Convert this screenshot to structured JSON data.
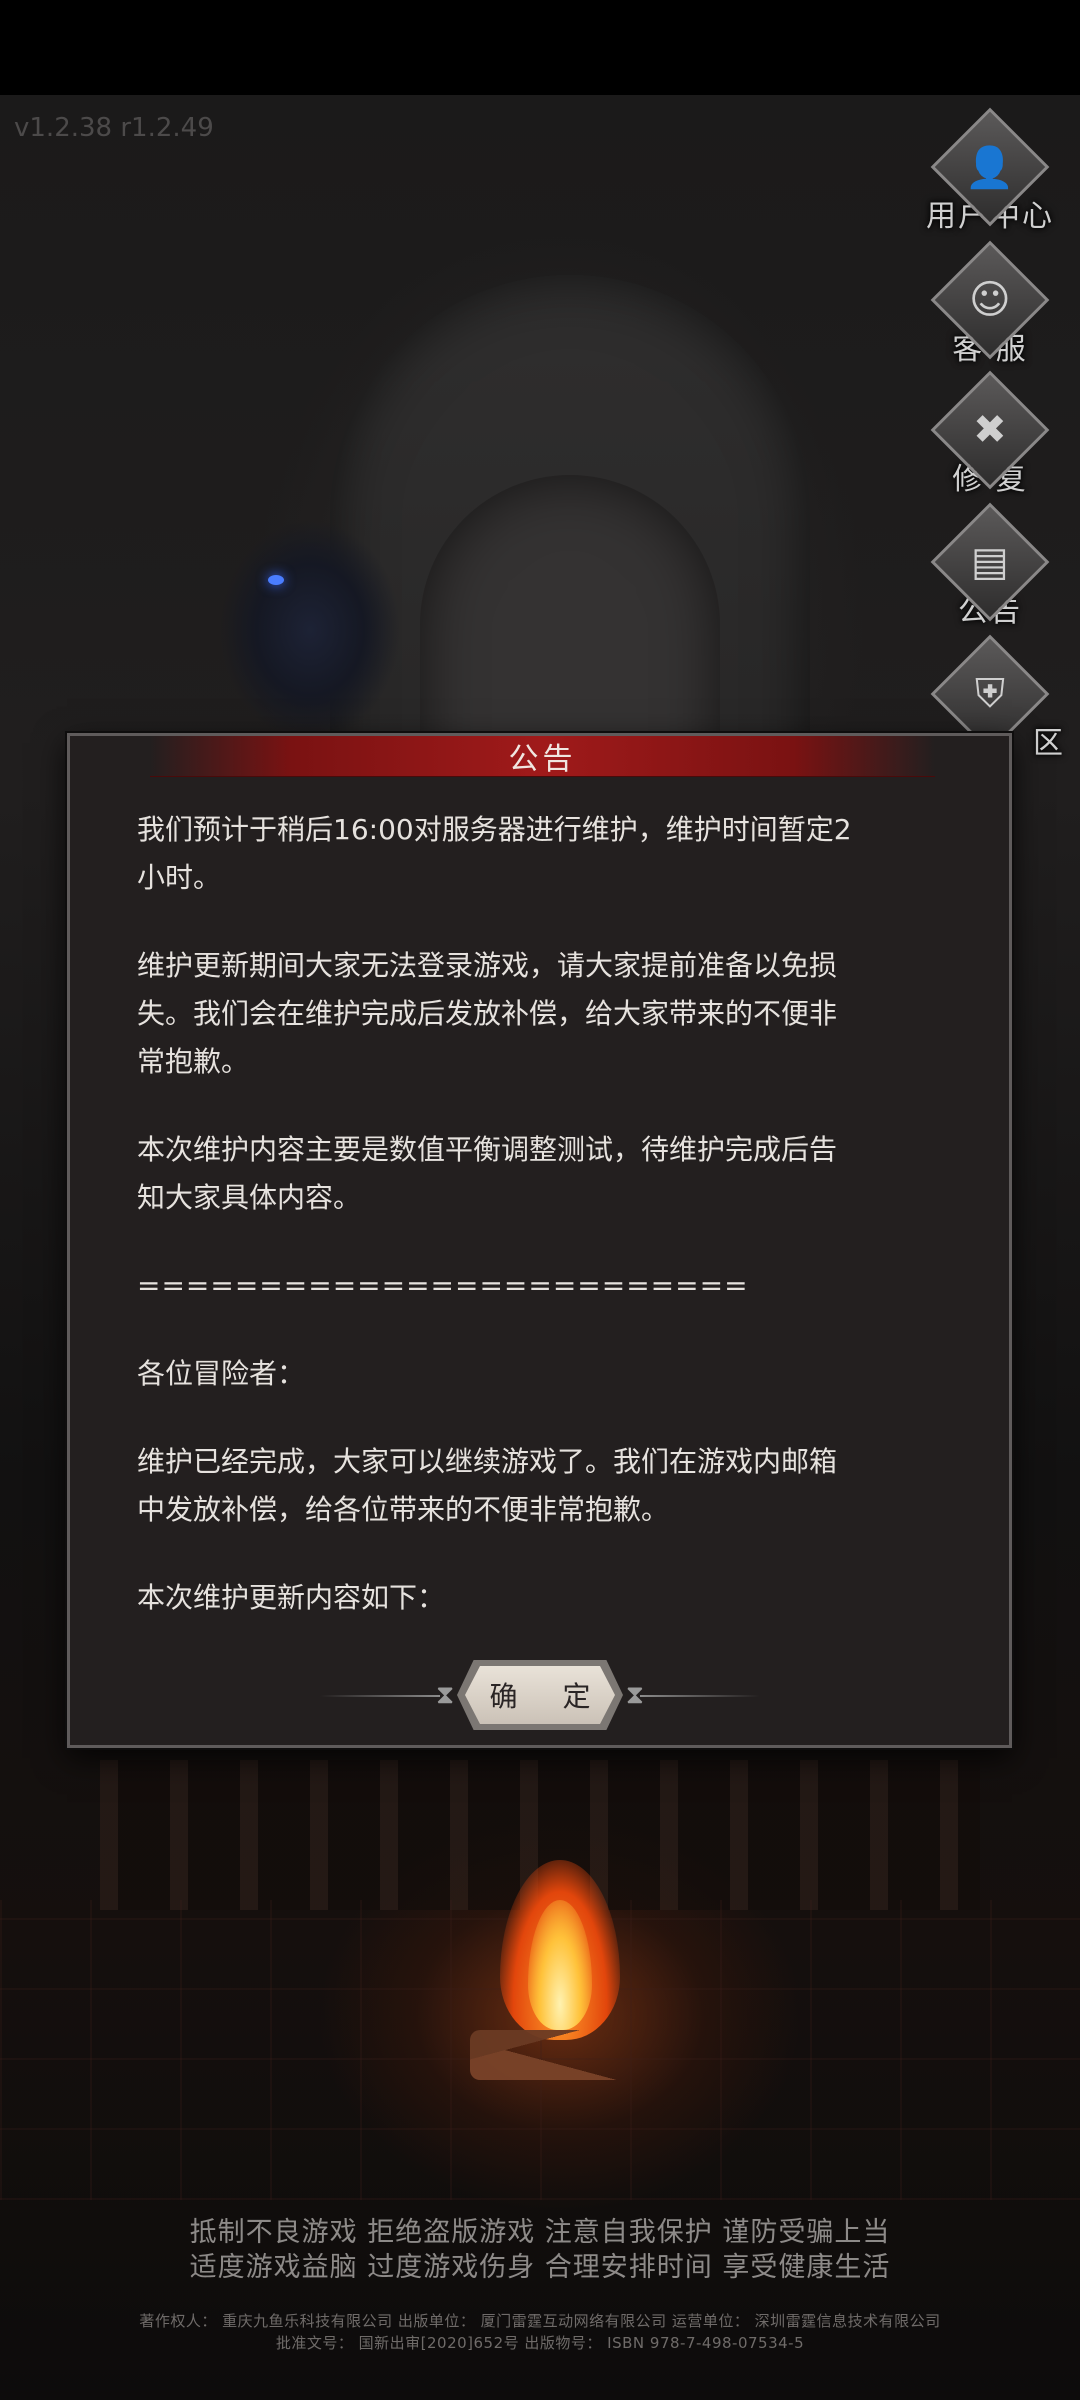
{
  "version": "v1.2.38 r1.2.49",
  "side_menu": [
    {
      "label": "用户中心",
      "icon": "user-icon",
      "glyph": "👤"
    },
    {
      "label": "客 服",
      "icon": "support-agent-icon",
      "glyph": "☺"
    },
    {
      "label": "修 复",
      "icon": "repair-tools-icon",
      "glyph": "✖"
    },
    {
      "label": "公告",
      "icon": "announcement-scroll-icon",
      "glyph": "▤"
    },
    {
      "label": "区",
      "icon": "server-knight-icon",
      "glyph": "⛨"
    }
  ],
  "dialog": {
    "title": "公告",
    "paragraphs": [
      "我们预计于稍后16:00对服务器进行维护，维护时间暂定2\n小时。",
      "维护更新期间大家无法登录游戏，请大家提前准备以免损\n失。我们会在维护完成后发放补偿，给大家带来的不便非\n常抱歉。",
      "本次维护内容主要是数值平衡调整测试，待维护完成后告\n知大家具体内容。",
      "=========================",
      "各位冒险者：",
      "维护已经完成，大家可以继续游戏了。我们在游戏内邮箱\n中发放补偿，给各位带来的不便非常抱歉。",
      "本次维护更新内容如下："
    ],
    "confirm_label": "确 定"
  },
  "health_notice": {
    "line1": "抵制不良游戏 拒绝盗版游戏 注意自我保护 谨防受骗上当",
    "line2": "适度游戏益脑 过度游戏伤身 合理安排时间 享受健康生活"
  },
  "credits": {
    "line1": "著作权人：  重庆九鱼乐科技有限公司  出版单位：  厦门雷霆互动网络有限公司  运营单位：  深圳雷霆信息技术有限公司",
    "line2": "批准文号：  国新出审[2020]652号  出版物号：  ISBN 978-7-498-07534-5"
  }
}
